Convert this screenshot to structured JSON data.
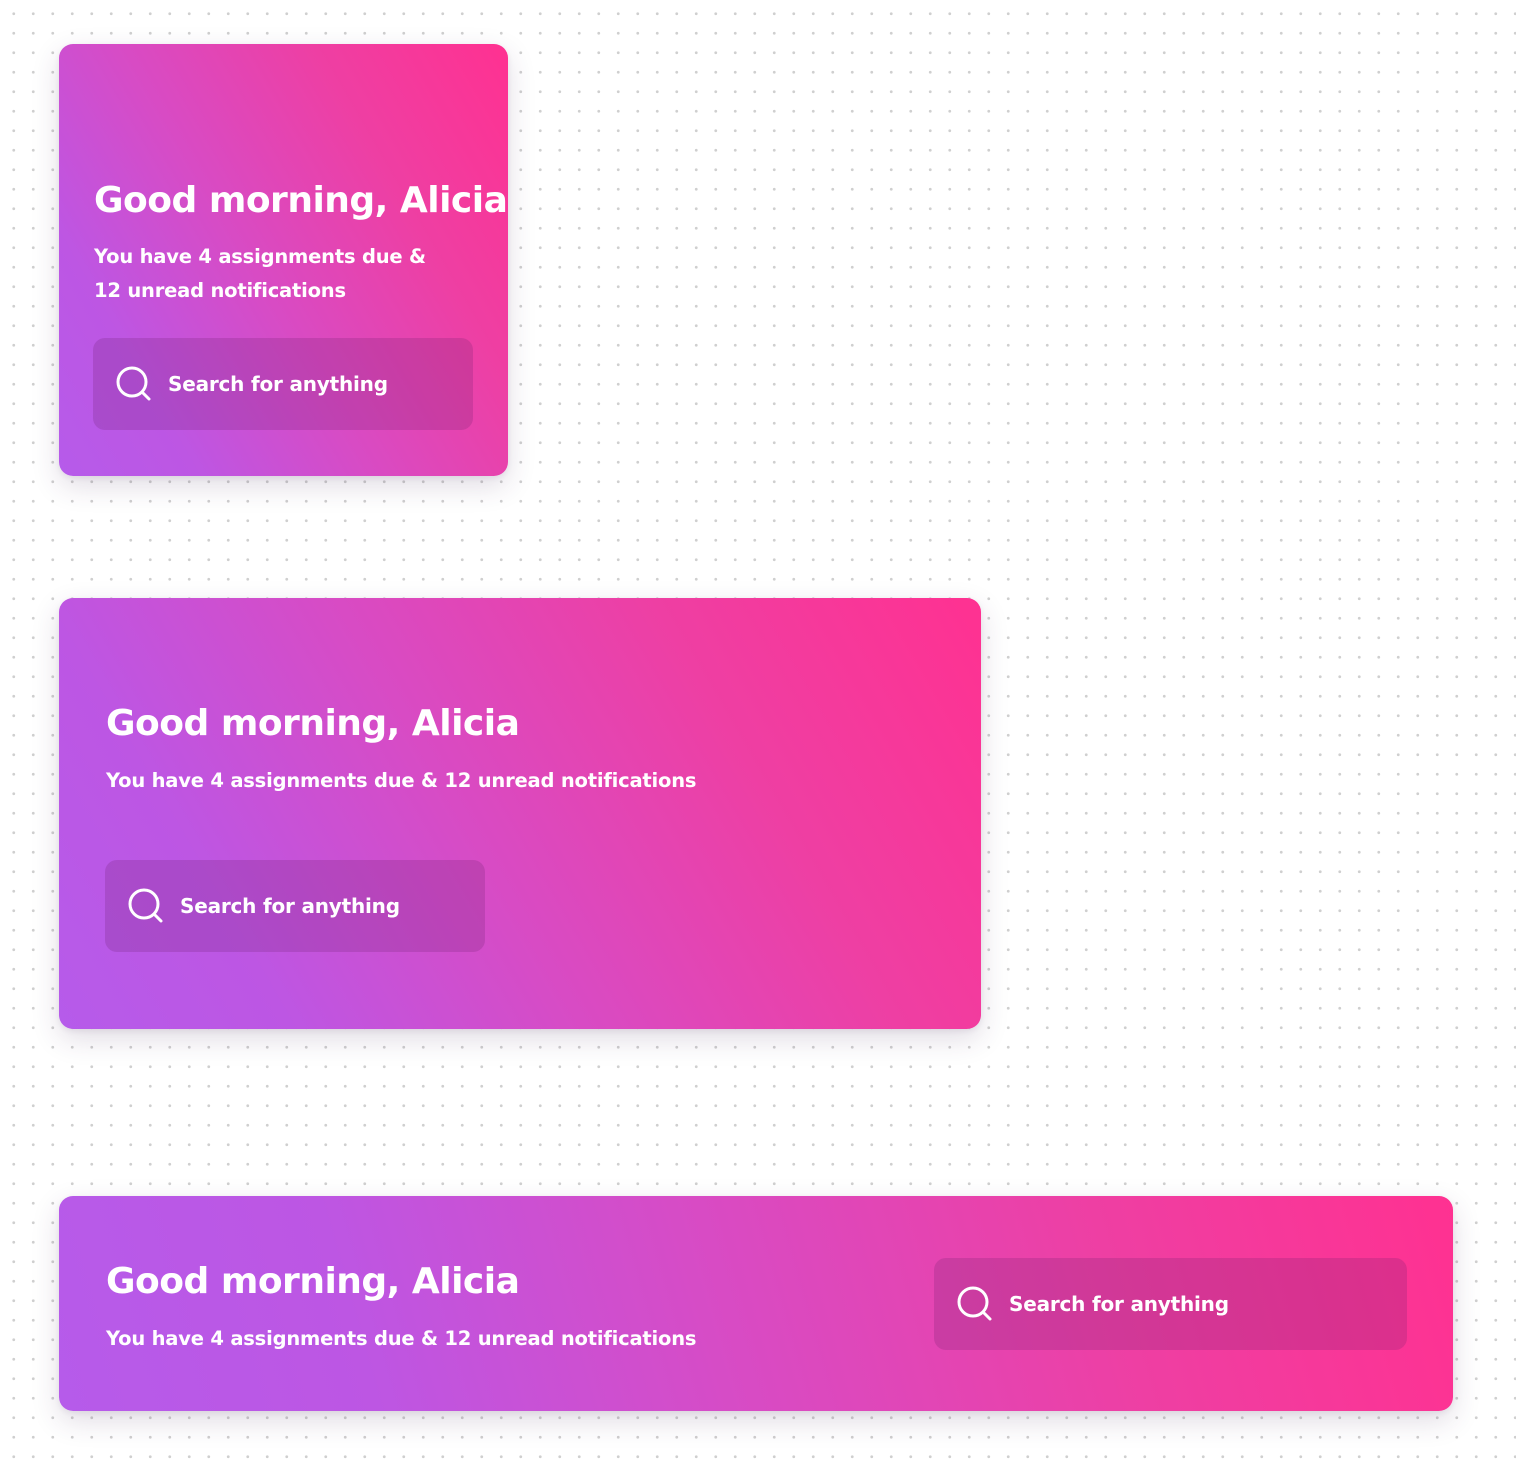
{
  "cards": [
    {
      "variant": "compact",
      "greeting": "Good morning, Alicia",
      "subtitle_line1": "You have 4 assignments due &",
      "subtitle_line2": "12 unread notifications",
      "search": {
        "placeholder": "Search for anything",
        "icon": "search-icon"
      }
    },
    {
      "variant": "medium",
      "greeting": "Good morning, Alicia",
      "subtitle": "You have 4 assignments due & 12 unread notifications",
      "search": {
        "placeholder": "Search for anything",
        "icon": "search-icon"
      }
    },
    {
      "variant": "wide",
      "greeting": "Good morning, Alicia",
      "subtitle": "You have 4 assignments due & 12 unread notifications",
      "search": {
        "placeholder": "Search for anything",
        "icon": "search-icon"
      }
    }
  ],
  "colors": {
    "gradient_start": "#b65bea",
    "gradient_end": "#ff3191",
    "text": "#ffffff",
    "canvas_background": "#ffffff",
    "canvas_dots": "#cfcfcf"
  }
}
